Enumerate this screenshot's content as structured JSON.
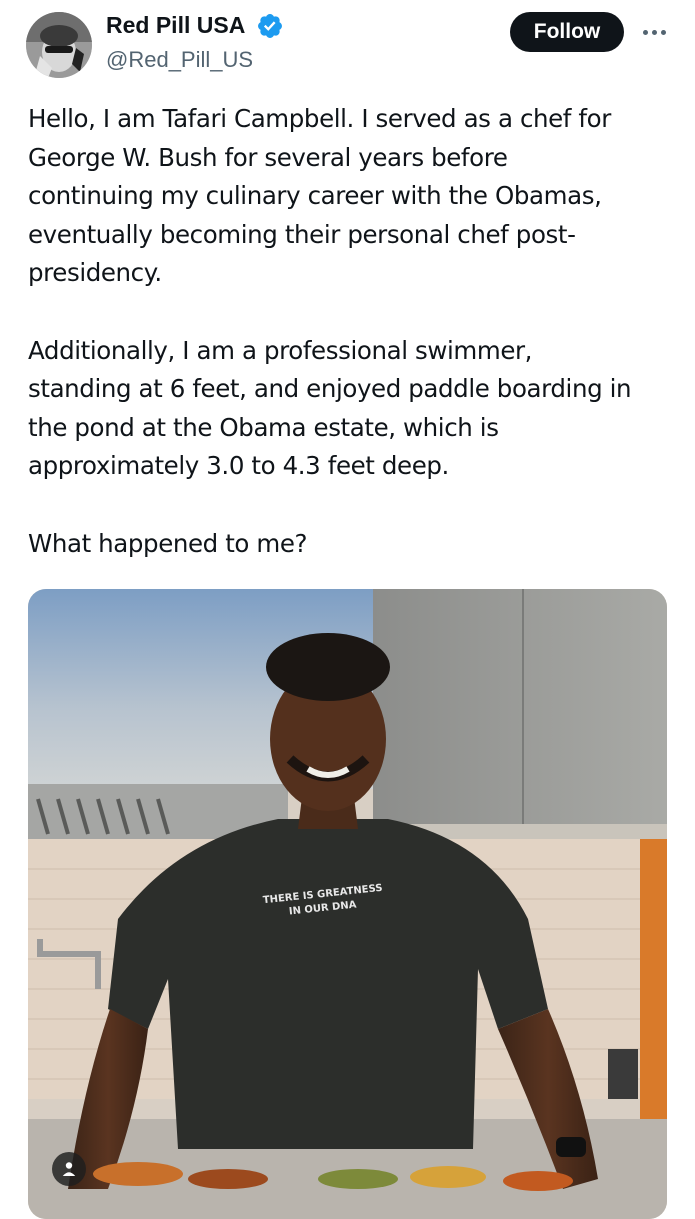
{
  "author": {
    "display_name": "Red Pill USA",
    "handle": "@Red_Pill_US",
    "verified_icon": "verified-badge-icon",
    "verified_color": "#1d9bf0"
  },
  "actions": {
    "follow_label": "Follow",
    "more_icon": "more-options-icon"
  },
  "tweet": {
    "paragraphs": [
      [
        "Hello, I am Tafari Campbell. I served as a chef for",
        "George W. Bush for several years before",
        "continuing my culinary career with the Obamas,",
        "eventually becoming their personal chef post-",
        "presidency."
      ],
      [
        "Additionally, I am a professional swimmer,",
        "standing at 6 feet, and enjoyed paddle boarding in",
        "the pond at the Obama estate, which is",
        "approximately 3.0 to 4.3 feet deep."
      ],
      [
        "What happened to me?"
      ]
    ]
  },
  "media": {
    "shirt_text_line1": "THERE IS GREATNESS",
    "shirt_text_line2": "IN OUR DNA",
    "corner_icon": "person-icon"
  },
  "colors": {
    "text_primary": "#0f1419",
    "text_secondary": "#536471",
    "follow_bg": "#0f1419",
    "follow_text": "#ffffff"
  }
}
